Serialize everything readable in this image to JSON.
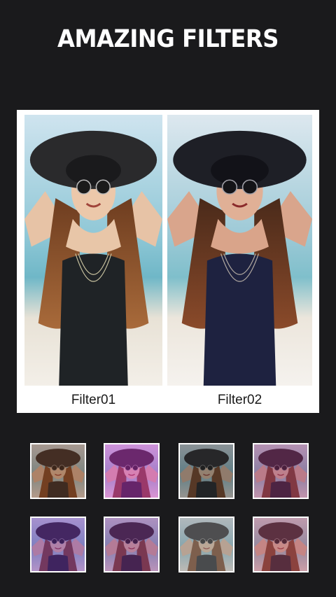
{
  "headline": "AMAZING FILTERS",
  "comparison": {
    "left_caption": "Filter01",
    "right_caption": "Filter02"
  },
  "filters": [
    {
      "name": "sepia-warm",
      "tint": "#6b3a1f"
    },
    {
      "name": "magenta",
      "tint": "#c02cc0"
    },
    {
      "name": "dark-contrast",
      "tint": "#2b2b2b"
    },
    {
      "name": "plum",
      "tint": "#8a2a6a"
    },
    {
      "name": "violet",
      "tint": "#6a2aa8"
    },
    {
      "name": "purple-pink",
      "tint": "#7a2a8a"
    },
    {
      "name": "black-white",
      "tint": "#808080"
    },
    {
      "name": "rose",
      "tint": "#a04060"
    }
  ]
}
